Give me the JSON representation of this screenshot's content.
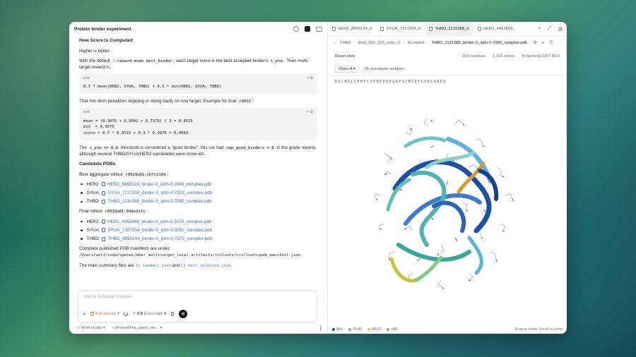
{
  "left": {
    "title": "Protein binder experiment",
    "dots": "···",
    "section_heading": "How Score Is Computed",
    "higher_better": "Higher is better.",
    "p1_a": "With the default ",
    "p1_code1": "--reward-mode best_binder",
    "p1_b": ", each target score is the best accepted binder's ",
    "p1_code2": "i_ptm",
    "p1_c": ". Then multi-target reward is:",
    "code1": {
      "lang": "text",
      "text": "0.7 * mean(HER2, SYUA, THBD) + 0.3 * min(HER2, SYUA, THBD)"
    },
    "p2_a": "That min term penalizes skipping or doing badly on one target. Example for final ",
    "p2_code": "r0032",
    "p2_b": ":",
    "code2": {
      "lang": "text",
      "text": "mean = (0.3075 + 0.3092 + 0.7379) / 3 = 0.4515\nmin  = 0.3075\nscore = 0.7 * 0.4515 + 0.3 * 0.3075 = 0.4083"
    },
    "p3_a": "The ",
    "p3_code1": "i_ptm >= 0.8",
    "p3_b": " threshold is considered a \"good binder\"; this run had ",
    "p3_code2": "num_good_binders = 0",
    "p3_c": " in the grade reports, although several THBD/SYUA/HER2 candidates were close-ish.",
    "candidates_heading": "Candidate PDBs",
    "best_label": "Best aggregate rollout ",
    "best_code": "r0029w01-cb7c210d",
    "best_colon": ":",
    "best_items": [
      {
        "target": "HER2:",
        "file": "HER2_8665124_binder-0_iptm-0.1846_complex.pdb"
      },
      {
        "target": "SYUA:",
        "file": "SYUA_7217208_binder-0_iptm-0.7523_complex.pdb"
      },
      {
        "target": "THBD:",
        "file": "THBD_1131388_binder-0_iptm-0.7080_complex.pdb"
      }
    ],
    "final_label": "Final rollout ",
    "final_code": "r0032w01-044e2cfc",
    "final_colon": ":",
    "final_items": [
      {
        "target": "HER2:",
        "file": "HER2_4453668_binder-0_iptm-0.3075_complex.pdb"
      },
      {
        "target": "SYUA:",
        "file": "SYUA_7357004_binder-0_iptm-0.3092_complex.pdb"
      },
      {
        "target": "THBD:",
        "file": "THBD_9950144_binder-0_iptm-0.7379_complex.pdb"
      }
    ],
    "manifest_text": "Complete published PDB manifests are under:",
    "manifest_path": "/Users/wolf/code/openai/mber_multitarget_local_artifacts/rollouts/<rollout>/pdb_manifest.json",
    "manifest_end": ".",
    "summary_a": "The main summary files are ",
    "summary_link1": "summary.json",
    "summary_and": " and ",
    "summary_link2": "best_solution.json",
    "summary_end": ".",
    "composer": {
      "placeholder": "Ask for follow-up changes",
      "access": "Full access",
      "model": "5.5",
      "effort": "Extra High"
    },
    "footer": {
      "work": "Work locally",
      "branch": "dev/wolf/lmp_agent_me..."
    }
  },
  "right": {
    "tabs": [
      {
        "label": "HER2_8665124_b",
        "active": false
      },
      {
        "label": "SYUA_7217208_b",
        "active": false
      },
      {
        "label": "THBD_1131388_b",
        "active": true
      },
      {
        "label": "HER2_4453668_",
        "active": false
      }
    ],
    "breadcrumb": [
      "THBD",
      "thbd_250_320_auto_r1",
      "Accepted",
      "THBD_1131388_binder-0_iptm-0.7080_complex.pdb"
    ],
    "reset": "Reset view",
    "residues": "163 residues",
    "atoms": "1,165 atoms",
    "bfactor": "B-factor/pLDDT 89.0",
    "chain": "Chain A",
    "coord": "35 coordinate residues",
    "sequence": "DSCNDLCEHFCVPNPDQPGSYSCMCETGYRLAADQ",
    "legend": [
      {
        "label": "90+",
        "color": "#1e4fa8"
      },
      {
        "label": "70-90",
        "color": "#5fb0e6"
      },
      {
        "label": "50-70",
        "color": "#e5d34a"
      },
      {
        "label": "<50",
        "color": "#e08a3c"
      }
    ],
    "hint": "Drag to rotate. Scroll to zoom"
  }
}
